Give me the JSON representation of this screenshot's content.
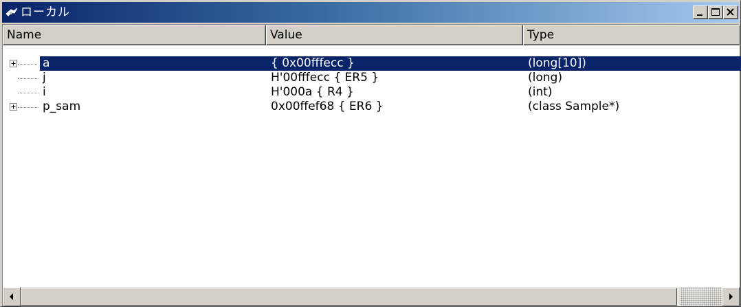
{
  "window": {
    "title": "ローカル",
    "title_icon": "watch-variable-icon",
    "buttons": [
      "minimize",
      "maximize",
      "close"
    ]
  },
  "columns": {
    "name": "Name",
    "value": "Value",
    "type": "Type"
  },
  "rows": [
    {
      "name": "a",
      "value": "{ 0x00fffecc }",
      "type": "(long[10])",
      "expandable": true,
      "selected": true
    },
    {
      "name": "j",
      "value": "H'00fffecc { ER5 }",
      "type": "(long)",
      "expandable": false,
      "selected": false
    },
    {
      "name": "i",
      "value": "H'000a { R4 }",
      "type": "(int)",
      "expandable": false,
      "selected": false
    },
    {
      "name": "p_sam",
      "value": "0x00ffef68 { ER6 }",
      "type": "(class Sample*)",
      "expandable": true,
      "selected": false
    }
  ],
  "colors": {
    "title_active": "#0a246a",
    "selection": "#0a246a",
    "face": "#d4d0c8"
  }
}
